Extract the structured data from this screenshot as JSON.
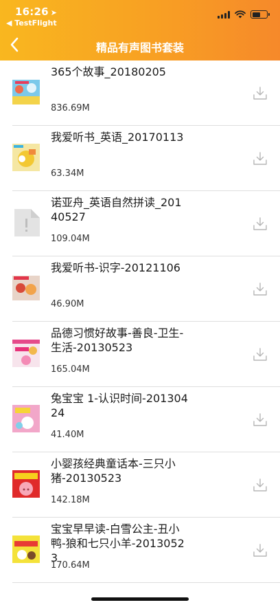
{
  "status_bar": {
    "time": "16:26",
    "back_app": "◀ TestFlight"
  },
  "nav": {
    "title": "精品有声图书套装"
  },
  "colors": {
    "header_start": "#f9b71f",
    "header_end": "#f6892a",
    "divider": "#dedede",
    "download_icon": "#b5b5b5"
  },
  "items": [
    {
      "title": "365个故事_20180205",
      "size": "836.69M",
      "cover": "book-cover-colorful"
    },
    {
      "title": "我爱听书_英语_20170113",
      "size": "63.34M",
      "cover": "book-cover-yellow"
    },
    {
      "title": "诺亚舟_英语自然拼读_20140527",
      "size": "109.04M",
      "cover": "file-placeholder-icon"
    },
    {
      "title": "我爱听书-识字-20121106",
      "size": "46.90M",
      "cover": "book-cover-red"
    },
    {
      "title": "品德习惯好故事-善良-卫生-生活-20130523",
      "size": "165.04M",
      "cover": "book-cover-pink"
    },
    {
      "title": "兔宝宝 1-认识时间-20130424",
      "size": "41.40M",
      "cover": "book-cover-bunny"
    },
    {
      "title": "小婴孩经典童话本-三只小猪-20130523",
      "size": "142.18M",
      "cover": "book-cover-three-pigs"
    },
    {
      "title": "宝宝早早读-白雪公主-丑小鸭-狼和七只小羊-20130523",
      "size": "170.64M",
      "cover": "book-cover-seven-goats"
    }
  ]
}
